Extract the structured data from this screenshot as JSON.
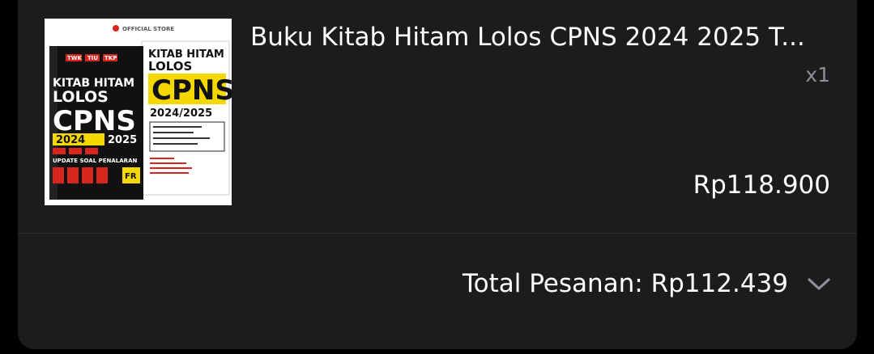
{
  "item": {
    "title": "Buku Kitab Hitam Lolos CPNS 2024 2025 T...",
    "quantity": "x1",
    "price": "Rp118.900"
  },
  "cover": {
    "store_badge": "OFFICIAL STORE",
    "front_title_1": "KITAB HITAM",
    "front_title_2": "LOLOS",
    "front_title_3": "CPNS",
    "front_year_a": "2024",
    "front_year_b": "2025",
    "tags": [
      "TWK",
      "TIU",
      "TKP"
    ],
    "back_title_1": "KITAB HITAM",
    "back_title_2": "LOLOS",
    "back_title_3": "CPNS",
    "back_year": "2024/2025",
    "update_text": "UPDATE SOAL PENALARAN",
    "fr_label": "FR"
  },
  "summary": {
    "total_label": "Total Pesanan: Rp112.439"
  },
  "icons": {
    "expand": "chevron-down-icon"
  },
  "colors": {
    "background": "#000000",
    "card": "#1c1c1e",
    "muted_text": "#8e8e93",
    "cover_yellow": "#f5d800",
    "cover_red": "#d7261e"
  }
}
